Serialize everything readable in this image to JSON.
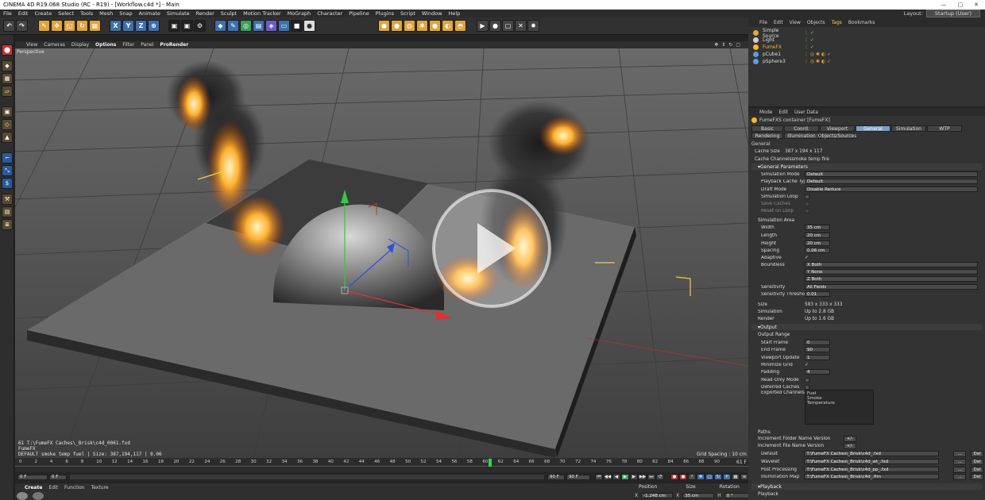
{
  "window": {
    "title": "CINEMA 4D R19.068 Studio (RC - R19) - [Workflow.c4d *] - Main",
    "minimize": "—",
    "maximize": "▢",
    "close": "✕"
  },
  "menu": [
    "File",
    "Edit",
    "Create",
    "Select",
    "Tools",
    "Mesh",
    "Snap",
    "Animate",
    "Simulate",
    "Render",
    "Sculpt",
    "Motion Tracker",
    "MoGraph",
    "Character",
    "Pipeline",
    "Plugins",
    "Script",
    "Window",
    "Help"
  ],
  "layout": {
    "label": "Layout:",
    "value": "Startup (User)"
  },
  "viewport": {
    "menu": [
      "View",
      "Cameras",
      "Display",
      "Options",
      "Filter",
      "Panel",
      "ProRender"
    ],
    "active_menu": "Options",
    "camera": "Perspective",
    "grid_spacing": "Grid Spacing : 10 cm",
    "overlay_lines": [
      "61 T:\\FumeFX Caches\\_Brisk\\c4d_0061.fxd",
      "FumeFX",
      "DEFAULT smoke temp fuel | Size: 387,194,117 | 0.06"
    ]
  },
  "timeline": {
    "ticks": [
      "0",
      "2",
      "4",
      "6",
      "8",
      "10",
      "12",
      "14",
      "16",
      "18",
      "20",
      "22",
      "24",
      "26",
      "28",
      "30",
      "32",
      "34",
      "36",
      "38",
      "40",
      "42",
      "44",
      "46",
      "48",
      "50",
      "52",
      "54",
      "56",
      "58",
      "60",
      "62",
      "64",
      "66",
      "68",
      "70",
      "72",
      "74",
      "76",
      "78",
      "80",
      "82",
      "84",
      "86",
      "88",
      "90"
    ],
    "current_marker": "61 F",
    "playhead": 61,
    "start_field": "0 F",
    "min_field": "0 F",
    "end_field": "90 F",
    "max_field": "90 F"
  },
  "bottom": {
    "tabs": [
      "Create",
      "Edit",
      "Function",
      "Texture"
    ],
    "coord_headers": [
      "Position",
      "Size",
      "Rotation"
    ],
    "pos_x": "-1.248 cm",
    "size_x": "35 cm",
    "rot_h": "0 °",
    "x_label": "X",
    "h_label": "H"
  },
  "objects": {
    "menu": [
      "File",
      "Edit",
      "View",
      "Objects",
      "Tags",
      "Bookmarks"
    ],
    "active_menu": "Tags",
    "items": [
      {
        "name": "Simple Source",
        "color": "#e8a53c"
      },
      {
        "name": "Light",
        "color": "#cfcfcf"
      },
      {
        "name": "FumeFX",
        "color": "#ffb22d",
        "selected": true
      },
      {
        "name": "pCube1",
        "color": "#5aa0e0"
      },
      {
        "name": "pSphere3",
        "color": "#5aa0e0"
      }
    ]
  },
  "attributes": {
    "menu": [
      "Mode",
      "Edit",
      "User Data"
    ],
    "container": "FumeFXS container [FumeFX]",
    "tabs_row1": [
      "Basic",
      "Coord.",
      "Viewport",
      "General",
      "Simulation",
      "WTP"
    ],
    "active_tab": "General",
    "tabs_row2": [
      "Rendering",
      "Illumination",
      "Objects/Sources"
    ],
    "general_header": "General",
    "cache_size_label": "Cache Size",
    "cache_size_value": "387 x 194 x 117",
    "cache_channels_label": "Cache Channels",
    "cache_channels_value": "smoke temp fire",
    "general_params_header": "General Parameters",
    "simulation_mode_label": "Simulation Mode",
    "simulation_mode_value": "Default",
    "playback_cache_label": "Playback Cache Type",
    "playback_cache_value": "Default",
    "draft_mode_label": "Draft Mode",
    "draft_mode_value": "Disable Reduce",
    "simulation_loop_label": "Simulation Loop",
    "save_caches_label": "Save Caches",
    "reset_on_loop_label": "Reset on Loop",
    "sim_area_label": "Simulation Area",
    "width_label": "Width",
    "width_value": "35 cm",
    "length_label": "Length",
    "length_value": "20 cm",
    "height_label": "Height",
    "height_value": "20 cm",
    "spacing_label": "Spacing",
    "spacing_value": "0.06 cm",
    "adaptive_label": "Adaptive",
    "boundless_label": "Boundless",
    "boundless_x": "X Both",
    "boundless_y": "Y None",
    "boundless_z": "Z Both",
    "sensitivity_label": "Sensitivity",
    "sensitivity_value": "All Fields",
    "sens_threshold_label": "Sensitivity Threshold",
    "sens_threshold_value": "0.01",
    "size_label": "Size",
    "size_value": "583 x 333 x 333",
    "simulation_label": "Simulation",
    "simulation_value": "Up to 2.8 GB",
    "render_label": "Render",
    "render_value": "Up to 1.6 GB",
    "output_header": "Output",
    "output_range_label": "Output Range",
    "start_frame_label": "Start Frame",
    "start_frame_value": "0",
    "end_frame_label": "End Frame",
    "end_frame_value": "90",
    "viewport_update_label": "Viewport Update",
    "viewport_update_value": "1",
    "minimize_grid_label": "Minimize Grid",
    "padding_label": "Padding",
    "padding_value": "4",
    "read_only_label": "Read-Only Mode",
    "deferred_label": "Deferred Caches",
    "exported_label": "Exported Channels",
    "exported_channels": [
      "Fuel",
      "Smoke",
      "Temperature"
    ],
    "paths_label": "Paths",
    "inc_folder_label": "Increment Folder Name Version",
    "inc_file_label": "Increment File Name Version",
    "inc_btn": "+/-",
    "default_label": "Default",
    "default_path": "T:\\FumeFX Caches\\_Brisk\\c4d_.fxd",
    "wavelet_label": "Wavelet",
    "wavelet_path": "T:\\FumeFX Caches\\_Brisk\\c4d_wt_.fxd",
    "post_label": "Post Processing",
    "post_path": "T:\\FumeFX Caches\\_Brisk\\c4d_pp_.fxd",
    "illum_label": "Illumination Map",
    "illum_path": "T:\\FumeFX Caches\\_Brisk\\c4d_.fim",
    "browse": "...",
    "del": "Del",
    "playback_header": "Playback",
    "playback_label": "Playback"
  }
}
